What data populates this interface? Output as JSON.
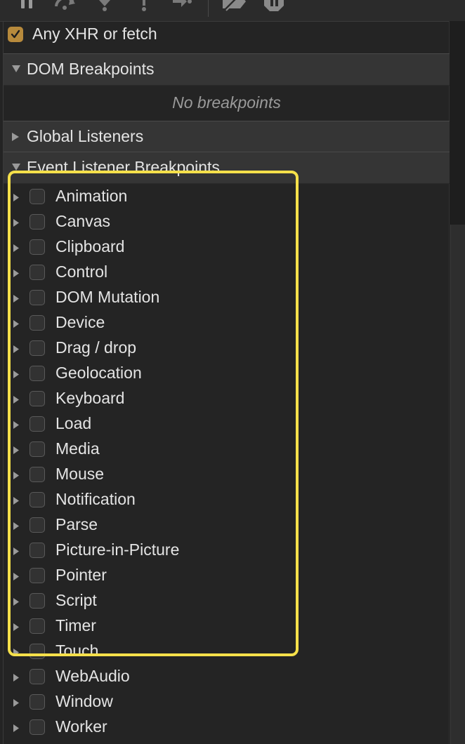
{
  "toolbar": {
    "icons": [
      "pause-icon",
      "step-over-icon",
      "step-into-icon",
      "step-out-icon",
      "step-icon",
      "deactivate-breakpoints-icon",
      "pause-on-exceptions-icon"
    ]
  },
  "xhr": {
    "label": "Any XHR or fetch",
    "checked": true
  },
  "sections": {
    "dom_breakpoints": "DOM Breakpoints",
    "no_breakpoints": "No breakpoints",
    "global_listeners": "Global Listeners",
    "event_listener_breakpoints": "Event Listener Breakpoints"
  },
  "events": [
    "Animation",
    "Canvas",
    "Clipboard",
    "Control",
    "DOM Mutation",
    "Device",
    "Drag / drop",
    "Geolocation",
    "Keyboard",
    "Load",
    "Media",
    "Mouse",
    "Notification",
    "Parse",
    "Picture-in-Picture",
    "Pointer",
    "Script",
    "Timer",
    "Touch",
    "WebAudio",
    "Window",
    "Worker"
  ],
  "colors": {
    "highlight": "#f5e04a",
    "checkbox_checked": "#b78a3c"
  }
}
